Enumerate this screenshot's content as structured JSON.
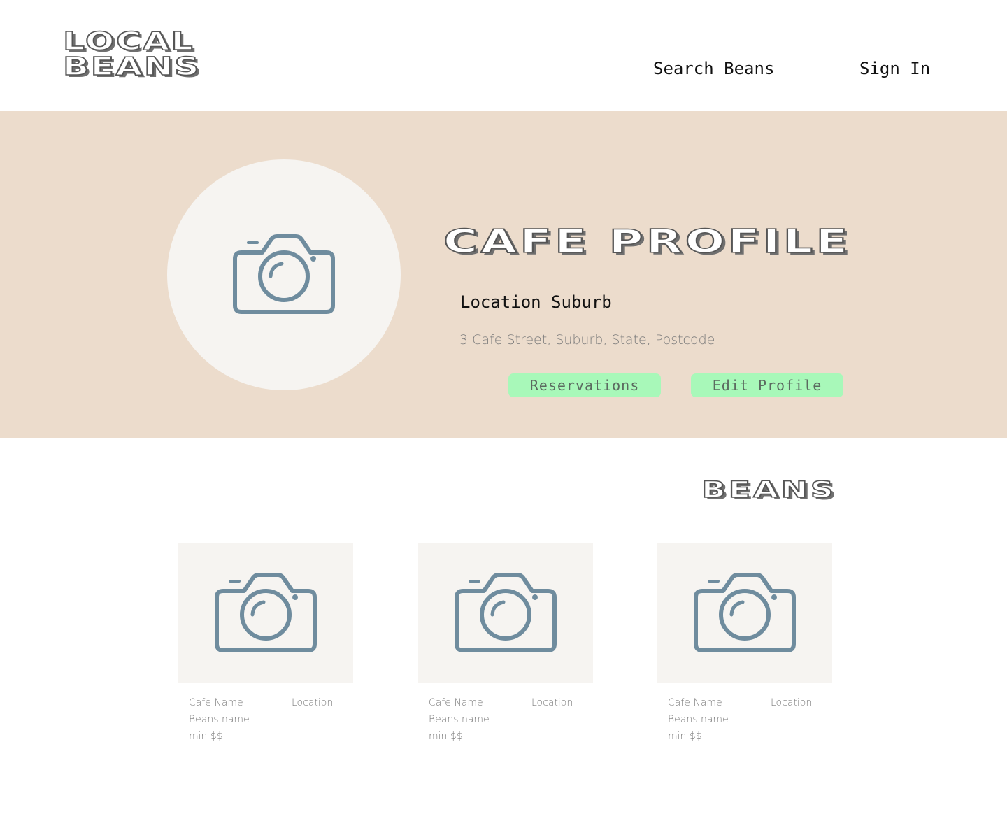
{
  "header": {
    "logo_line1": "LOCAL",
    "logo_line2": "BEANS",
    "nav": {
      "search_beans": "Search Beans",
      "sign_in": "Sign In"
    }
  },
  "hero": {
    "title": "CAFE PROFILE",
    "location_suburb": "Location Suburb",
    "address": "3 Cafe Street, Suburb, State, Postcode",
    "buttons": {
      "reservations": "Reservations",
      "edit_profile": "Edit Profile"
    },
    "avatar_icon": "camera-icon"
  },
  "beans": {
    "title": "BEANS",
    "cards": [
      {
        "cafe_name": "Cafe Name",
        "separator": "|",
        "location": "Location",
        "beans_name": "Beans name",
        "price": "min $$",
        "image_icon": "camera-icon"
      },
      {
        "cafe_name": "Cafe Name",
        "separator": "|",
        "location": "Location",
        "beans_name": "Beans name",
        "price": "min $$",
        "image_icon": "camera-icon"
      },
      {
        "cafe_name": "Cafe Name",
        "separator": "|",
        "location": "Location",
        "beans_name": "Beans name",
        "price": "min $$",
        "image_icon": "camera-icon"
      }
    ]
  },
  "colors": {
    "hero_background": "#ecdccc",
    "placeholder_background": "#f6f4f1",
    "icon": "#6f8c9e",
    "button": "#a8f8b9"
  }
}
